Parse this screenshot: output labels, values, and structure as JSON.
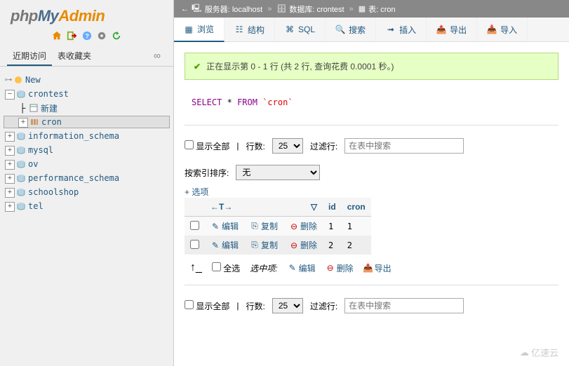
{
  "logo": {
    "php": "php",
    "my": "My",
    "admin": "Admin"
  },
  "recent_label": "近期访问",
  "fav_label": "表收藏夹",
  "tree": {
    "new": "New",
    "crontest": "crontest",
    "new_sub": "新建",
    "cron": "cron",
    "info_schema": "information_schema",
    "mysql": "mysql",
    "ov": "ov",
    "perf_schema": "performance_schema",
    "schoolshop": "schoolshop",
    "tel": "tel"
  },
  "breadcrumb": {
    "server_label": "服务器:",
    "server": "localhost",
    "db_label": "数据库:",
    "db": "crontest",
    "table_label": "表:",
    "table": "cron"
  },
  "tabs": {
    "browse": "浏览",
    "structure": "结构",
    "sql": "SQL",
    "search": "搜索",
    "insert": "插入",
    "export": "导出",
    "import": "导入"
  },
  "success_msg": "正在显示第 0 - 1 行 (共 2 行, 查询花费 0.0001 秒。)",
  "sql": {
    "select": "SELECT",
    "star": "*",
    "from": "FROM",
    "table": "`cron`"
  },
  "showall": "显示全部",
  "rows_label": "行数:",
  "rows_value": "25",
  "filter_label": "过滤行:",
  "filter_placeholder": "在表中搜索",
  "sort_label": "按索引排序:",
  "sort_value": "无",
  "options_link": "+ 选项",
  "table_headers": {
    "arrows": "←T→",
    "id": "id",
    "cron": "cron"
  },
  "row_actions": {
    "edit": "编辑",
    "copy": "复制",
    "delete": "删除"
  },
  "rows": [
    {
      "id": "1",
      "cron": "1"
    },
    {
      "id": "2",
      "cron": "2"
    }
  ],
  "bulk": {
    "select_all": "全选",
    "with_selected": "选中项:",
    "edit": "编辑",
    "delete": "删除",
    "export": "导出"
  },
  "watermark": "亿速云"
}
